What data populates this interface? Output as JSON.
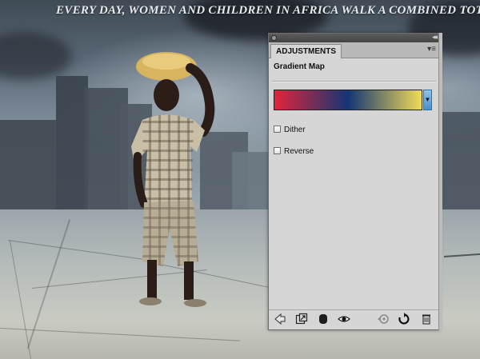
{
  "banner": {
    "text": "EVERY DAY, WOMEN AND CHILDREN IN AFRICA WALK A COMBINED TOTAL"
  },
  "panel": {
    "tab_label": "ADJUSTMENTS",
    "menu_icon": "panel-menu-icon",
    "adjustment_title": "Gradient Map",
    "gradient": {
      "stops": [
        "#e1253a",
        "#143574",
        "#f1dc56"
      ]
    },
    "options": {
      "dither_label": "Dither",
      "dither_checked": false,
      "reverse_label": "Reverse",
      "reverse_checked": false
    },
    "footer_icons": [
      "back-arrow-icon",
      "expand-view-icon",
      "clip-layer-icon",
      "visibility-eye-icon",
      "previous-state-icon",
      "reset-icon",
      "delete-icon"
    ]
  }
}
